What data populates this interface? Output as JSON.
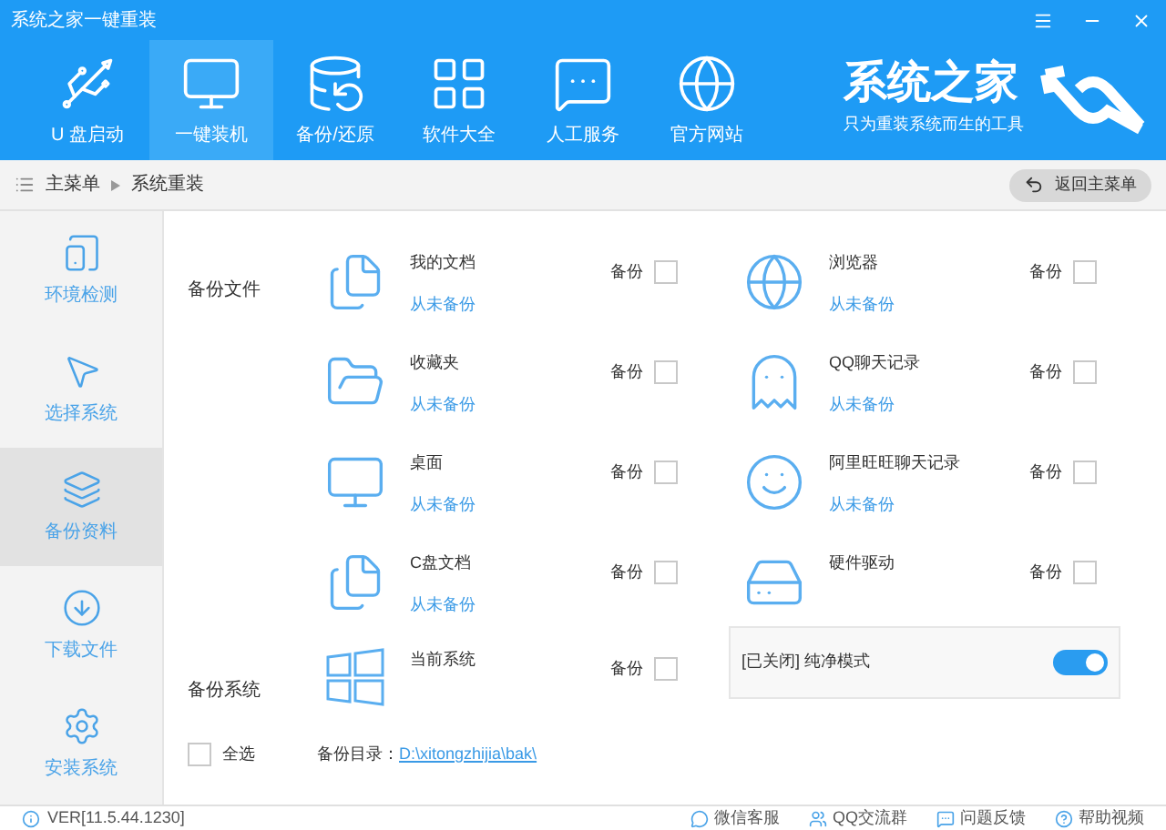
{
  "window": {
    "title": "系统之家一键重装"
  },
  "nav": [
    {
      "label": "U 盘启动",
      "selected": false
    },
    {
      "label": "一键装机",
      "selected": true
    },
    {
      "label": "备份/还原",
      "selected": false
    },
    {
      "label": "软件大全",
      "selected": false
    },
    {
      "label": "人工服务",
      "selected": false
    },
    {
      "label": "官方网站",
      "selected": false
    }
  ],
  "brand": {
    "title": "系统之家",
    "subtitle": "只为重装系统而生的工具"
  },
  "breadcrumb": {
    "items": [
      "主菜单",
      "系统重装"
    ],
    "back_button": "返回主菜单"
  },
  "sidebar": {
    "items": [
      {
        "label": "环境检测",
        "selected": false
      },
      {
        "label": "选择系统",
        "selected": false
      },
      {
        "label": "备份资料",
        "selected": true
      },
      {
        "label": "下载文件",
        "selected": false
      },
      {
        "label": "安装系统",
        "selected": false
      }
    ]
  },
  "backup_files": {
    "label": "备份文件",
    "items": [
      {
        "name": "我的文档",
        "status": "从未备份",
        "backup_label": "备份",
        "checked": false
      },
      {
        "name": "浏览器",
        "status": "从未备份",
        "backup_label": "备份",
        "checked": false
      },
      {
        "name": "收藏夹",
        "status": "从未备份",
        "backup_label": "备份",
        "checked": false
      },
      {
        "name": "QQ聊天记录",
        "status": "从未备份",
        "backup_label": "备份",
        "checked": false
      },
      {
        "name": "桌面",
        "status": "从未备份",
        "backup_label": "备份",
        "checked": false
      },
      {
        "name": "阿里旺旺聊天记录",
        "status": "从未备份",
        "backup_label": "备份",
        "checked": false
      },
      {
        "name": "C盘文档",
        "status": "从未备份",
        "backup_label": "备份",
        "checked": false
      },
      {
        "name": "硬件驱动",
        "backup_label": "备份",
        "checked": false
      }
    ]
  },
  "backup_system": {
    "label": "备份系统",
    "item": {
      "name": "当前系统",
      "backup_label": "备份",
      "checked": false
    },
    "toggle": {
      "label": "[已关闭] 纯净模式",
      "on": true
    }
  },
  "footer": {
    "select_all": {
      "label": "全选",
      "checked": false
    },
    "dir_label": "备份目录：",
    "dir_path": "D:\\xitongzhijia\\bak\\"
  },
  "status_bar": {
    "version": "VER[11.5.44.1230]",
    "links": [
      "微信客服",
      "QQ交流群",
      "问题反馈",
      "帮助视频"
    ]
  }
}
